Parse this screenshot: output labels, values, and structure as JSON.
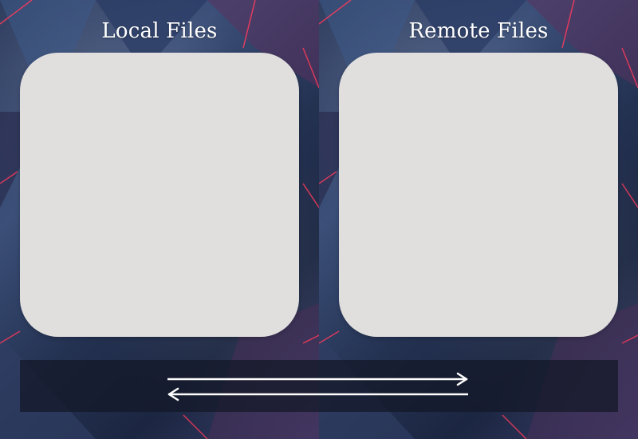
{
  "local_panel": {
    "title": "Local Files",
    "files": []
  },
  "remote_panel": {
    "title": "Remote Files",
    "files": []
  },
  "transfer_bar": {
    "upload_icon": "arrow-right-icon",
    "download_icon": "arrow-left-icon"
  },
  "colors": {
    "pane_background": "#e1dfde",
    "title_text": "#ffffff",
    "accent_red": "#ff3b5c",
    "arrow": "#ffffff"
  }
}
